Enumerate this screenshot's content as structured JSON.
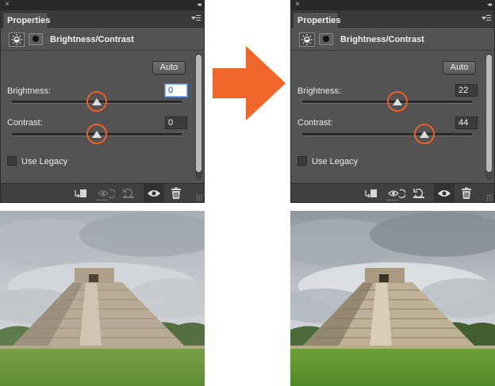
{
  "panels": [
    {
      "id": "left",
      "close_glyph": "×",
      "collapse_glyph": "◂◂",
      "tab_label": "Properties",
      "title": "Brightness/Contrast",
      "auto_label": "Auto",
      "brightness": {
        "label": "Brightness:",
        "value": "0",
        "slider_fraction": 0.5
      },
      "contrast": {
        "label": "Contrast:",
        "value": "0",
        "slider_fraction": 0.5
      },
      "legacy_label": "Use Legacy"
    },
    {
      "id": "right",
      "close_glyph": "×",
      "collapse_glyph": "◂◂",
      "tab_label": "Properties",
      "title": "Brightness/Contrast",
      "auto_label": "Auto",
      "brightness": {
        "label": "Brightness:",
        "value": "22",
        "slider_fraction": 0.56
      },
      "contrast": {
        "label": "Contrast:",
        "value": "44",
        "slider_fraction": 0.72
      },
      "legacy_label": "Use Legacy"
    }
  ],
  "colors": {
    "panel_bg": "#535353",
    "highlight_ring": "#ef5f26",
    "arrow": "#f0662a",
    "value_focus": "#ffffff"
  },
  "photo_variants": [
    "before",
    "after"
  ]
}
